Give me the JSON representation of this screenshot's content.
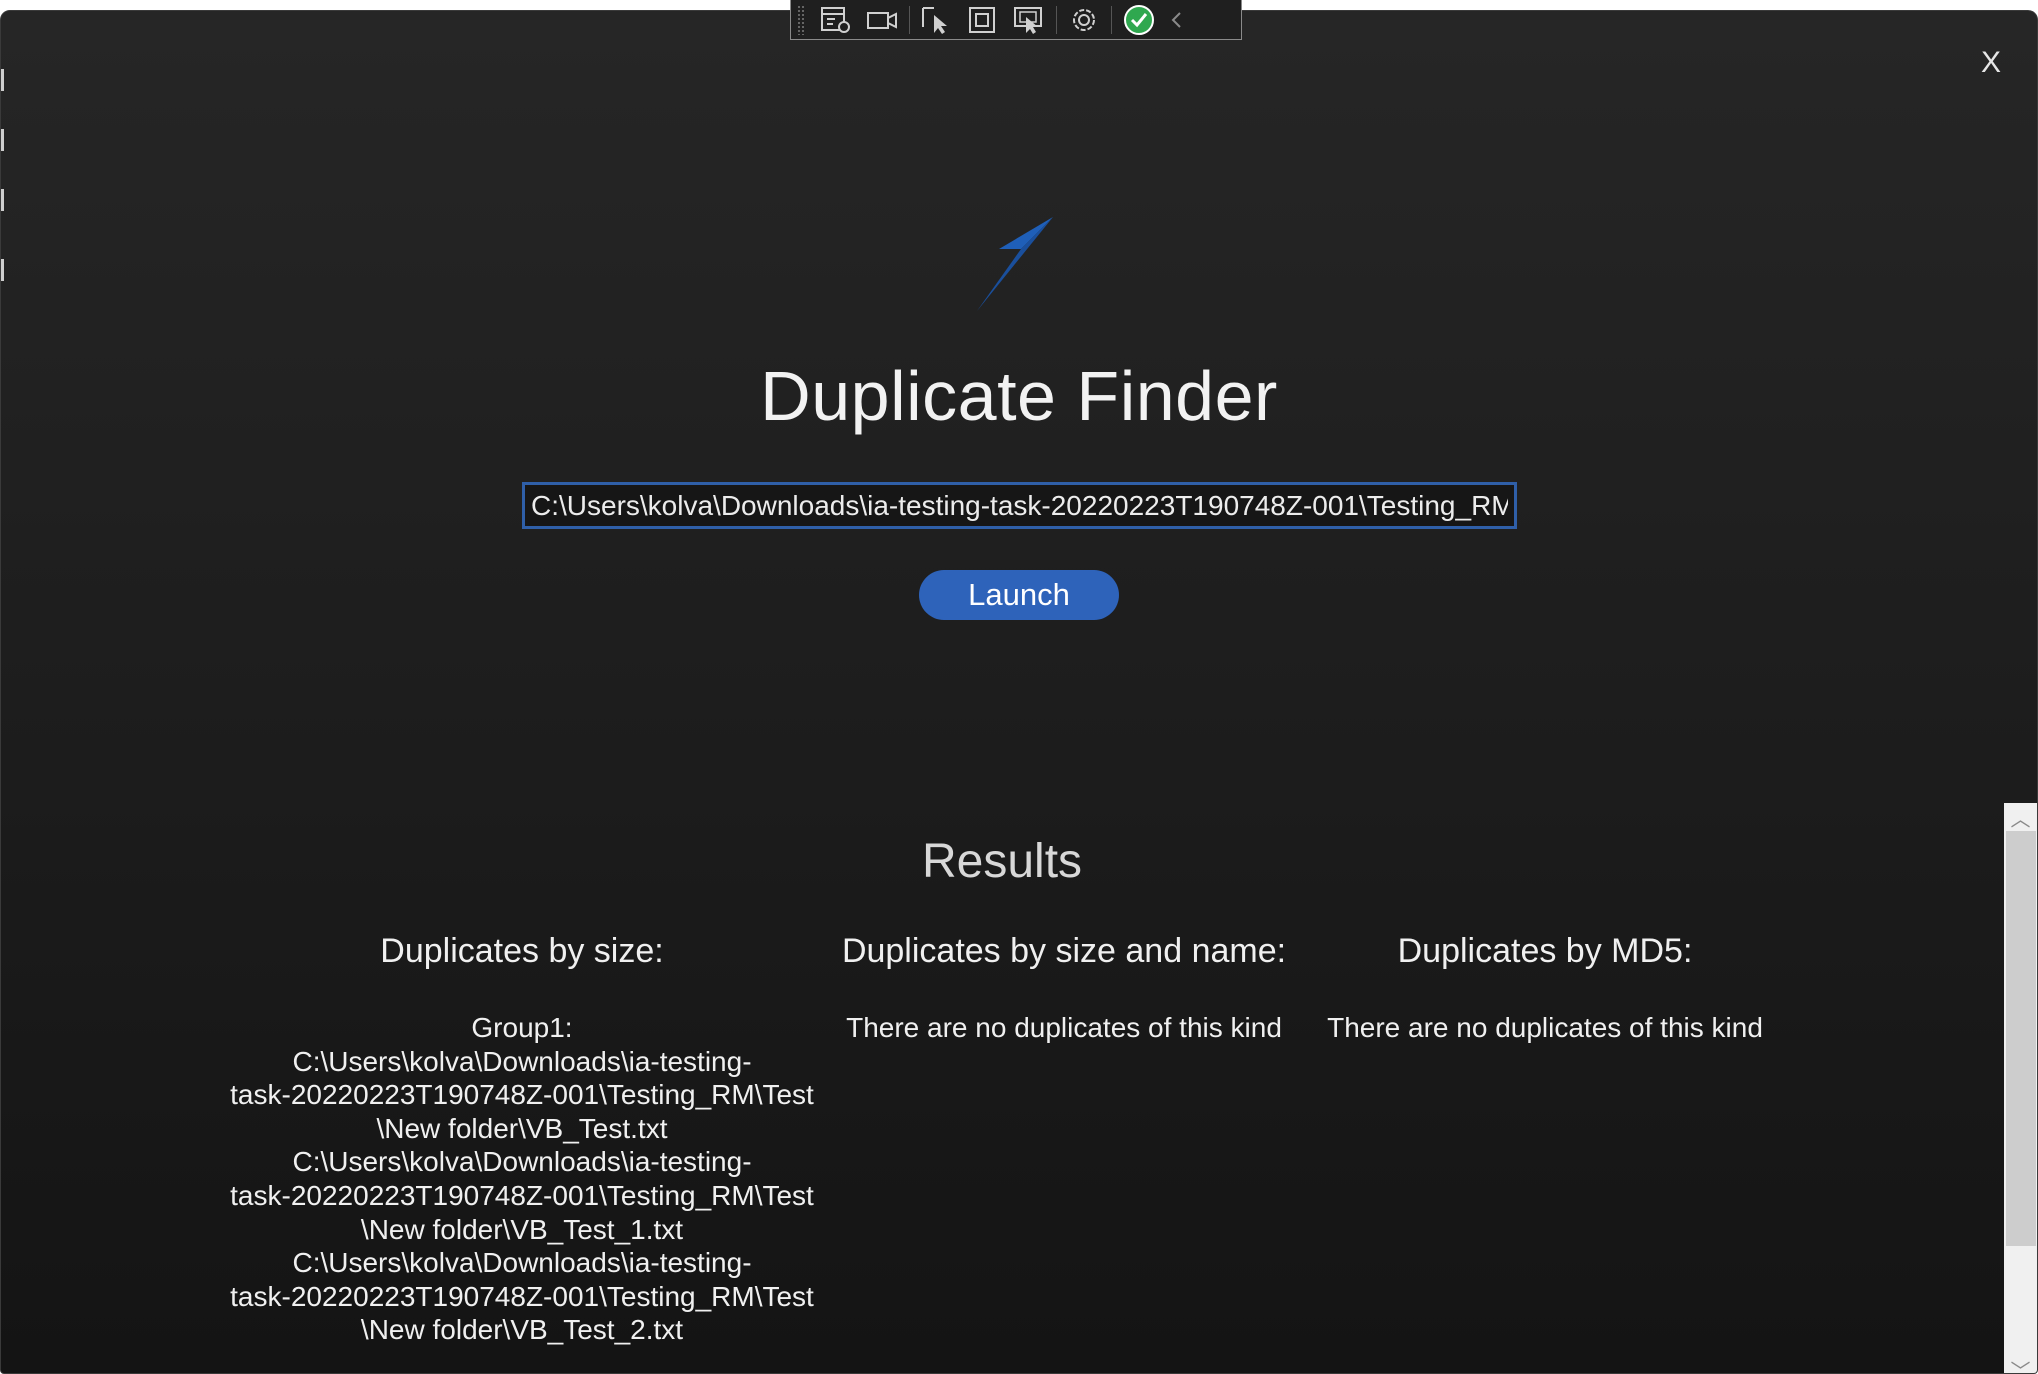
{
  "window": {
    "close_label": "X"
  },
  "toolbar": {
    "buttons": [
      "select-element-icon",
      "record-icon",
      "pointer-select-icon",
      "layout-bounds-icon",
      "screen-select-icon",
      "hot-reload-icon",
      "check-icon",
      "collapse-chevron-icon"
    ]
  },
  "app": {
    "title": "Duplicate Finder",
    "path_value": "C:\\Users\\kolva\\Downloads\\ia-testing-task-20220223T190748Z-001\\Testing_RM",
    "launch_label": "Launch",
    "accent_color": "#2e63ba"
  },
  "results": {
    "title": "Results",
    "by_size": {
      "heading": "Duplicates by size:",
      "lines": [
        "Group1:",
        "C:\\Users\\kolva\\Downloads\\ia-testing-",
        "task-20220223T190748Z-001\\Testing_RM\\Test",
        "\\New folder\\VB_Test.txt",
        "C:\\Users\\kolva\\Downloads\\ia-testing-",
        "task-20220223T190748Z-001\\Testing_RM\\Test",
        "\\New folder\\VB_Test_1.txt",
        "C:\\Users\\kolva\\Downloads\\ia-testing-",
        "task-20220223T190748Z-001\\Testing_RM\\Test",
        "\\New folder\\VB_Test_2.txt"
      ]
    },
    "by_size_and_name": {
      "heading": "Duplicates by size and name:",
      "text": "There are no duplicates of this kind"
    },
    "by_md5": {
      "heading": "Duplicates by MD5:",
      "text": "There are no duplicates of this kind"
    }
  },
  "scrollbar": {
    "up_glyph": "︿",
    "down_glyph": "﹀"
  }
}
